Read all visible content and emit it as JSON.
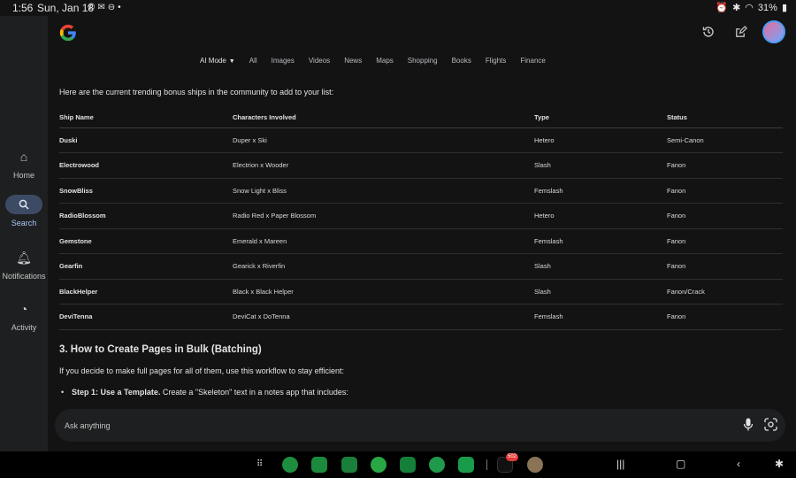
{
  "status": {
    "time": "1:56",
    "date": "Sun, Jan 18",
    "battery": "31%"
  },
  "rail": {
    "home": "Home",
    "search": "Search",
    "notifications": "Notifications",
    "activity": "Activity"
  },
  "tabs": [
    "AI Mode",
    "All",
    "Images",
    "Videos",
    "News",
    "Maps",
    "Shopping",
    "Books",
    "Flights",
    "Finance"
  ],
  "content": {
    "intro": "Here are the current trending bonus ships in the community to add to your list:",
    "headers": [
      "Ship Name",
      "Characters Involved",
      "Type",
      "Status"
    ],
    "rows": [
      [
        "Duski",
        "Duper x Ski",
        "Hetero",
        "Semi-Canon"
      ],
      [
        "Electrowood",
        "Electrion x Wooder",
        "Slash",
        "Fanon"
      ],
      [
        "SnowBliss",
        "Snow Light x Bliss",
        "Femslash",
        "Fanon"
      ],
      [
        "RadioBlossom",
        "Radio Red x Paper Blossom",
        "Hetero",
        "Fanon"
      ],
      [
        "Gemstone",
        "Emerald x Mareen",
        "Femslash",
        "Fanon"
      ],
      [
        "Gearfin",
        "Gearick x Riverfin",
        "Slash",
        "Fanon"
      ],
      [
        "BlackHelper",
        "Black x Black Helper",
        "Slash",
        "Fanon/Crack"
      ],
      [
        "DeviTenna",
        "DeviCat x DoTenna",
        "Femslash",
        "Fanon"
      ]
    ],
    "heading": "3. How to Create Pages in Bulk (Batching)",
    "paragraph": "If you decide to make full pages for all of them, use this workflow to stay efficient:",
    "bullet_bold": "Step 1: Use a Template.",
    "bullet_text": " Create a \"Skeleton\" text in a notes app that includes:"
  },
  "ask": {
    "placeholder": "Ask anything"
  },
  "taskbar": {
    "badge": "502"
  },
  "colors": {
    "accent": "#a8c7fa",
    "background": "#131314",
    "rail": "#1e1f20"
  }
}
